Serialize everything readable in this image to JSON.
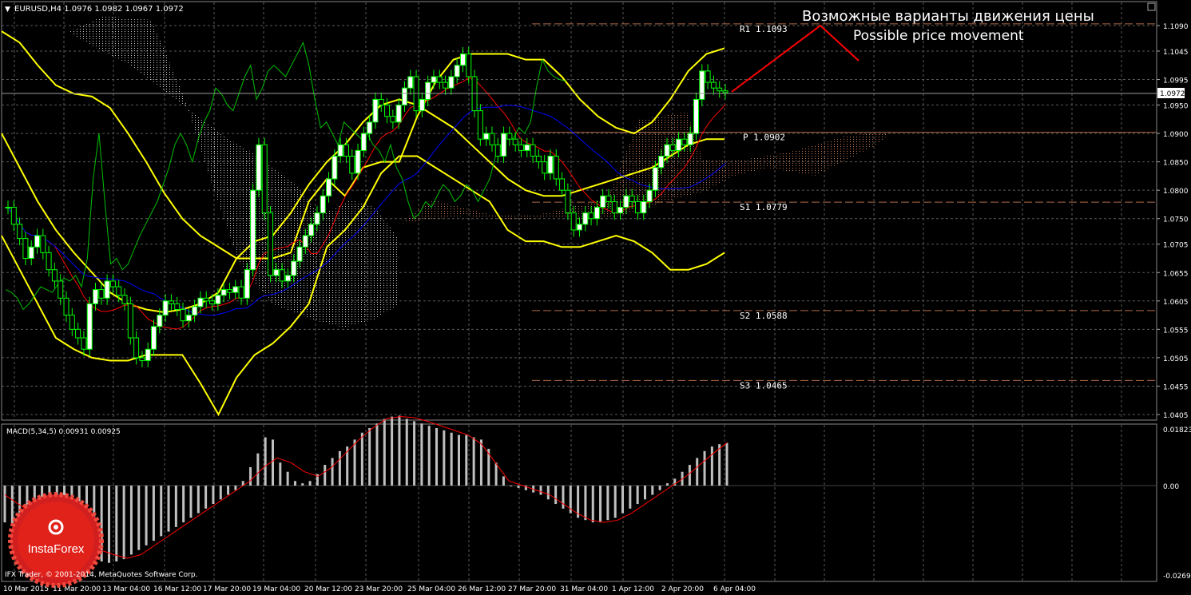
{
  "header": {
    "symbol_info": "EURUSD,H4  1.0976 1.0982 1.0967 1.0972"
  },
  "annotation": {
    "ru": "Возможные варианты движения цены",
    "en": "Possible price movement"
  },
  "current_price": "1.0972",
  "macd_label": "MACD(5,34,5) 0.00931 0.00925",
  "copyright": "IFX Trader, © 2001-2014, MetaQuotes Software Corp.",
  "logo_text": "InstaForex",
  "colors": {
    "background": "#000000",
    "grid": "#5a5a5a",
    "bull_candle": "#ffffff",
    "bear_candle": "#000000",
    "candle_border": "#00ff00",
    "bollinger": "#ffff00",
    "tenkan": "#ff0000",
    "kijun": "#0000ff",
    "chikou": "#00c000",
    "kumo": "#ffffff",
    "pivot_line": "#b06a4a",
    "annotation": "#ff0000",
    "macd_hist": "#c0c0c0",
    "macd_signal": "#ff0000",
    "logo": "#e0221b"
  },
  "chart_data": [
    {
      "type": "candlestick",
      "title": "EURUSD,H4",
      "price_axis_ticks": [
        "1.1090",
        "1.1045",
        "1.0995",
        "1.0950",
        "1.0900",
        "1.0850",
        "1.0800",
        "1.0750",
        "1.0705",
        "1.0655",
        "1.0605",
        "1.0555",
        "1.0505",
        "1.0455",
        "1.0405"
      ],
      "time_axis_ticks": [
        "10 Mar 2015",
        "11 Mar 20:00",
        "13 Mar 04:00",
        "16 Mar 12:00",
        "17 Mar 20:00",
        "19 Mar 04:00",
        "20 Mar 12:00",
        "23 Mar 20:00",
        "25 Mar 04:00",
        "26 Mar 12:00",
        "27 Mar 20:00",
        "31 Mar 04:00",
        "1 Apr 12:00",
        "2 Apr 20:00",
        "6 Apr 04:00"
      ],
      "ylim": [
        1.04,
        1.112
      ],
      "grid": true,
      "pivot_levels": [
        {
          "label": "R1  1.1093",
          "value": 1.1093
        },
        {
          "label": "P  1.0902",
          "value": 1.0902
        },
        {
          "label": "S1  1.0779",
          "value": 1.0779
        },
        {
          "label": "S2  1.0588",
          "value": 1.0588
        },
        {
          "label": "S3  1.0465",
          "value": 1.0465
        }
      ],
      "close": [
        1.077,
        1.074,
        1.0715,
        1.068,
        1.07,
        1.072,
        1.069,
        1.066,
        1.064,
        1.061,
        1.058,
        1.0555,
        1.054,
        1.052,
        1.06,
        1.0625,
        1.061,
        1.064,
        1.063,
        1.0615,
        1.06,
        1.054,
        1.0505,
        1.05,
        1.052,
        1.056,
        1.058,
        1.0605,
        1.06,
        1.059,
        1.057,
        1.058,
        1.0595,
        1.061,
        1.0605,
        1.06,
        1.0615,
        1.0625,
        1.062,
        1.063,
        1.061,
        1.066,
        1.08,
        1.088,
        1.076,
        1.065,
        1.066,
        1.064,
        1.065,
        1.0675,
        1.07,
        1.072,
        1.074,
        1.076,
        1.079,
        1.082,
        1.086,
        1.088,
        1.086,
        1.083,
        1.087,
        1.09,
        1.092,
        1.096,
        1.095,
        1.093,
        1.092,
        1.095,
        1.098,
        1.1,
        1.094,
        1.096,
        1.099,
        1.1,
        1.099,
        1.098,
        1.1,
        1.102,
        1.104,
        1.1,
        1.094,
        1.089,
        1.09,
        1.088,
        1.086,
        1.09,
        1.089,
        1.088,
        1.087,
        1.088,
        1.086,
        1.085,
        1.083,
        1.086,
        1.082,
        1.08,
        1.076,
        1.073,
        1.074,
        1.076,
        1.075,
        1.077,
        1.079,
        1.078,
        1.076,
        1.077,
        1.079,
        1.078,
        1.076,
        1.078,
        1.08,
        1.084,
        1.086,
        1.088,
        1.087,
        1.089,
        1.088,
        1.09,
        1.096,
        1.101,
        1.099,
        1.098,
        1.0975,
        1.0972
      ],
      "bollinger": {
        "upper": [
          1.108,
          1.106,
          1.102,
          1.0985,
          1.097,
          1.0965,
          1.0945,
          1.09,
          1.085,
          1.0795,
          1.075,
          1.072,
          1.07,
          1.068,
          1.068,
          1.068,
          1.069,
          1.078,
          1.082,
          1.079,
          1.084,
          1.085,
          1.085,
          1.093,
          1.099,
          1.103,
          1.104,
          1.104,
          1.104,
          1.103,
          1.103,
          1.1,
          1.096,
          1.093,
          1.091,
          1.09,
          1.092,
          1.096,
          1.101,
          1.104,
          1.105
        ],
        "middle": [
          1.09,
          1.084,
          1.078,
          1.073,
          1.069,
          1.0655,
          1.062,
          1.06,
          1.059,
          1.0585,
          1.059,
          1.06,
          1.062,
          1.068,
          1.071,
          1.072,
          1.076,
          1.081,
          1.085,
          1.088,
          1.092,
          1.095,
          1.096,
          1.095,
          1.093,
          1.091,
          1.088,
          1.085,
          1.082,
          1.08,
          1.079,
          1.079,
          1.08,
          1.081,
          1.082,
          1.083,
          1.084,
          1.086,
          1.088,
          1.089,
          1.089
        ],
        "lower": [
          1.072,
          1.066,
          1.06,
          1.054,
          1.052,
          1.0505,
          1.05,
          1.05,
          1.051,
          1.051,
          1.051,
          1.046,
          1.0405,
          1.047,
          1.051,
          1.053,
          1.056,
          1.06,
          1.07,
          1.073,
          1.077,
          1.083,
          1.086,
          1.086,
          1.084,
          1.082,
          1.08,
          1.078,
          1.073,
          1.071,
          1.071,
          1.07,
          1.07,
          1.071,
          1.072,
          1.071,
          1.069,
          1.066,
          1.066,
          1.067,
          1.069
        ]
      }
    },
    {
      "type": "bar",
      "title": "MACD(5,34,5) 0.00931 0.00925",
      "value_axis_ticks": [
        "0.01823",
        "0.00",
        "-0.02693"
      ],
      "ylim": [
        -0.02693,
        0.01823
      ],
      "histogram": [
        -0.008,
        -0.0085,
        -0.009,
        -0.0095,
        -0.01,
        -0.011,
        -0.012,
        -0.013,
        -0.014,
        -0.015,
        -0.0155,
        -0.016,
        -0.0162,
        -0.0165,
        -0.0168,
        -0.0165,
        -0.016,
        -0.015,
        -0.014,
        -0.013,
        -0.012,
        -0.011,
        -0.01,
        -0.009,
        -0.008,
        -0.007,
        -0.006,
        -0.005,
        -0.004,
        -0.003,
        -0.002,
        -0.001,
        0.001,
        0.004,
        0.007,
        0.0105,
        0.01,
        0.005,
        0.003,
        0.001,
        0.0005,
        0.001,
        0.0025,
        0.0045,
        0.006,
        0.0075,
        0.0085,
        0.01,
        0.0115,
        0.0125,
        0.0135,
        0.0145,
        0.015,
        0.0152,
        0.0145,
        0.014,
        0.0135,
        0.013,
        0.0125,
        0.012,
        0.0115,
        0.011,
        0.011,
        0.0105,
        0.01,
        0.008,
        0.005,
        0.002,
        0.0,
        -0.0005,
        -0.001,
        -0.0015,
        -0.002,
        -0.003,
        -0.004,
        -0.005,
        -0.006,
        -0.007,
        -0.0075,
        -0.008,
        -0.008,
        -0.0075,
        -0.007,
        -0.006,
        -0.005,
        -0.004,
        -0.003,
        -0.002,
        -0.001,
        0.0005,
        0.0015,
        0.003,
        0.0045,
        0.006,
        0.0075,
        0.0085,
        0.009,
        0.0093
      ],
      "signal": [
        -0.002,
        -0.004,
        -0.006,
        -0.008,
        -0.0095,
        -0.011,
        -0.0125,
        -0.014,
        -0.015,
        -0.0158,
        -0.015,
        -0.013,
        -0.011,
        -0.009,
        -0.007,
        -0.005,
        -0.003,
        -0.001,
        0.001,
        0.004,
        0.006,
        0.005,
        0.003,
        0.002,
        0.004,
        0.007,
        0.01,
        0.0125,
        0.0145,
        0.015,
        0.0148,
        0.014,
        0.013,
        0.012,
        0.011,
        0.009,
        0.005,
        0.001,
        0.0,
        -0.001,
        -0.002,
        -0.004,
        -0.006,
        -0.0075,
        -0.008,
        -0.0075,
        -0.006,
        -0.004,
        -0.002,
        0.0,
        0.002,
        0.0045,
        0.007,
        0.0093
      ]
    }
  ]
}
